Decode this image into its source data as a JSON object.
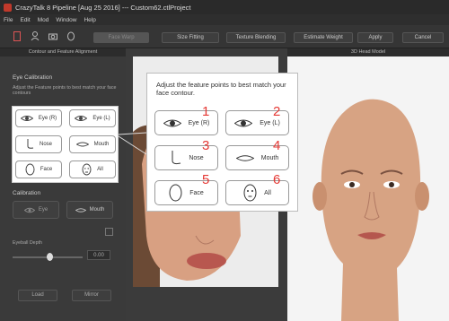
{
  "titlebar": {
    "title": "CrazyTalk 8 Pipeline [Aug 25 2016] --- Custom62.ctlProject"
  },
  "menu": [
    "File",
    "Edit",
    "Mod",
    "Window",
    "Help"
  ],
  "toolbar": {
    "face_wrap_label": "Face Warp",
    "size_fitting_label": "Size Fitting",
    "texture_blending_label": "Texture Blending",
    "estimate_weight_label": "Estimate Weight",
    "apply_label": "Apply",
    "cancel_label": "Cancel"
  },
  "left_panel": {
    "header": "Contour and Feature Alignment",
    "eye_calibration_title": "Eye Calibration",
    "instructions": "Adjust the Feature points to best match your face contours",
    "buttons": {
      "eye_r": "Eye (R)",
      "eye_l": "Eye (L)",
      "nose": "Nose",
      "mouth": "Mouth",
      "face": "Face",
      "all": "All"
    },
    "calibration_title": "Calibration",
    "calib_eye": "Eye",
    "calib_mouth": "Mouth",
    "eyeball_depth_label": "Eyeball Depth",
    "eyeball_depth_value": "0.00",
    "load_label": "Load",
    "mirror_label": "Mirror"
  },
  "right_panel": {
    "header": "3D Head Model"
  },
  "callout": {
    "text": "Adjust the feature points to best match your face contour.",
    "buttons": [
      {
        "num": "1",
        "label": "Eye (R)"
      },
      {
        "num": "2",
        "label": "Eye (L)"
      },
      {
        "num": "3",
        "label": "Nose"
      },
      {
        "num": "4",
        "label": "Mouth"
      },
      {
        "num": "5",
        "label": "Face"
      },
      {
        "num": "6",
        "label": "All"
      }
    ]
  },
  "colors": {
    "accent_red": "#e53935",
    "panel_dark": "#3a3a3a",
    "popup_bg": "#ffffff"
  }
}
